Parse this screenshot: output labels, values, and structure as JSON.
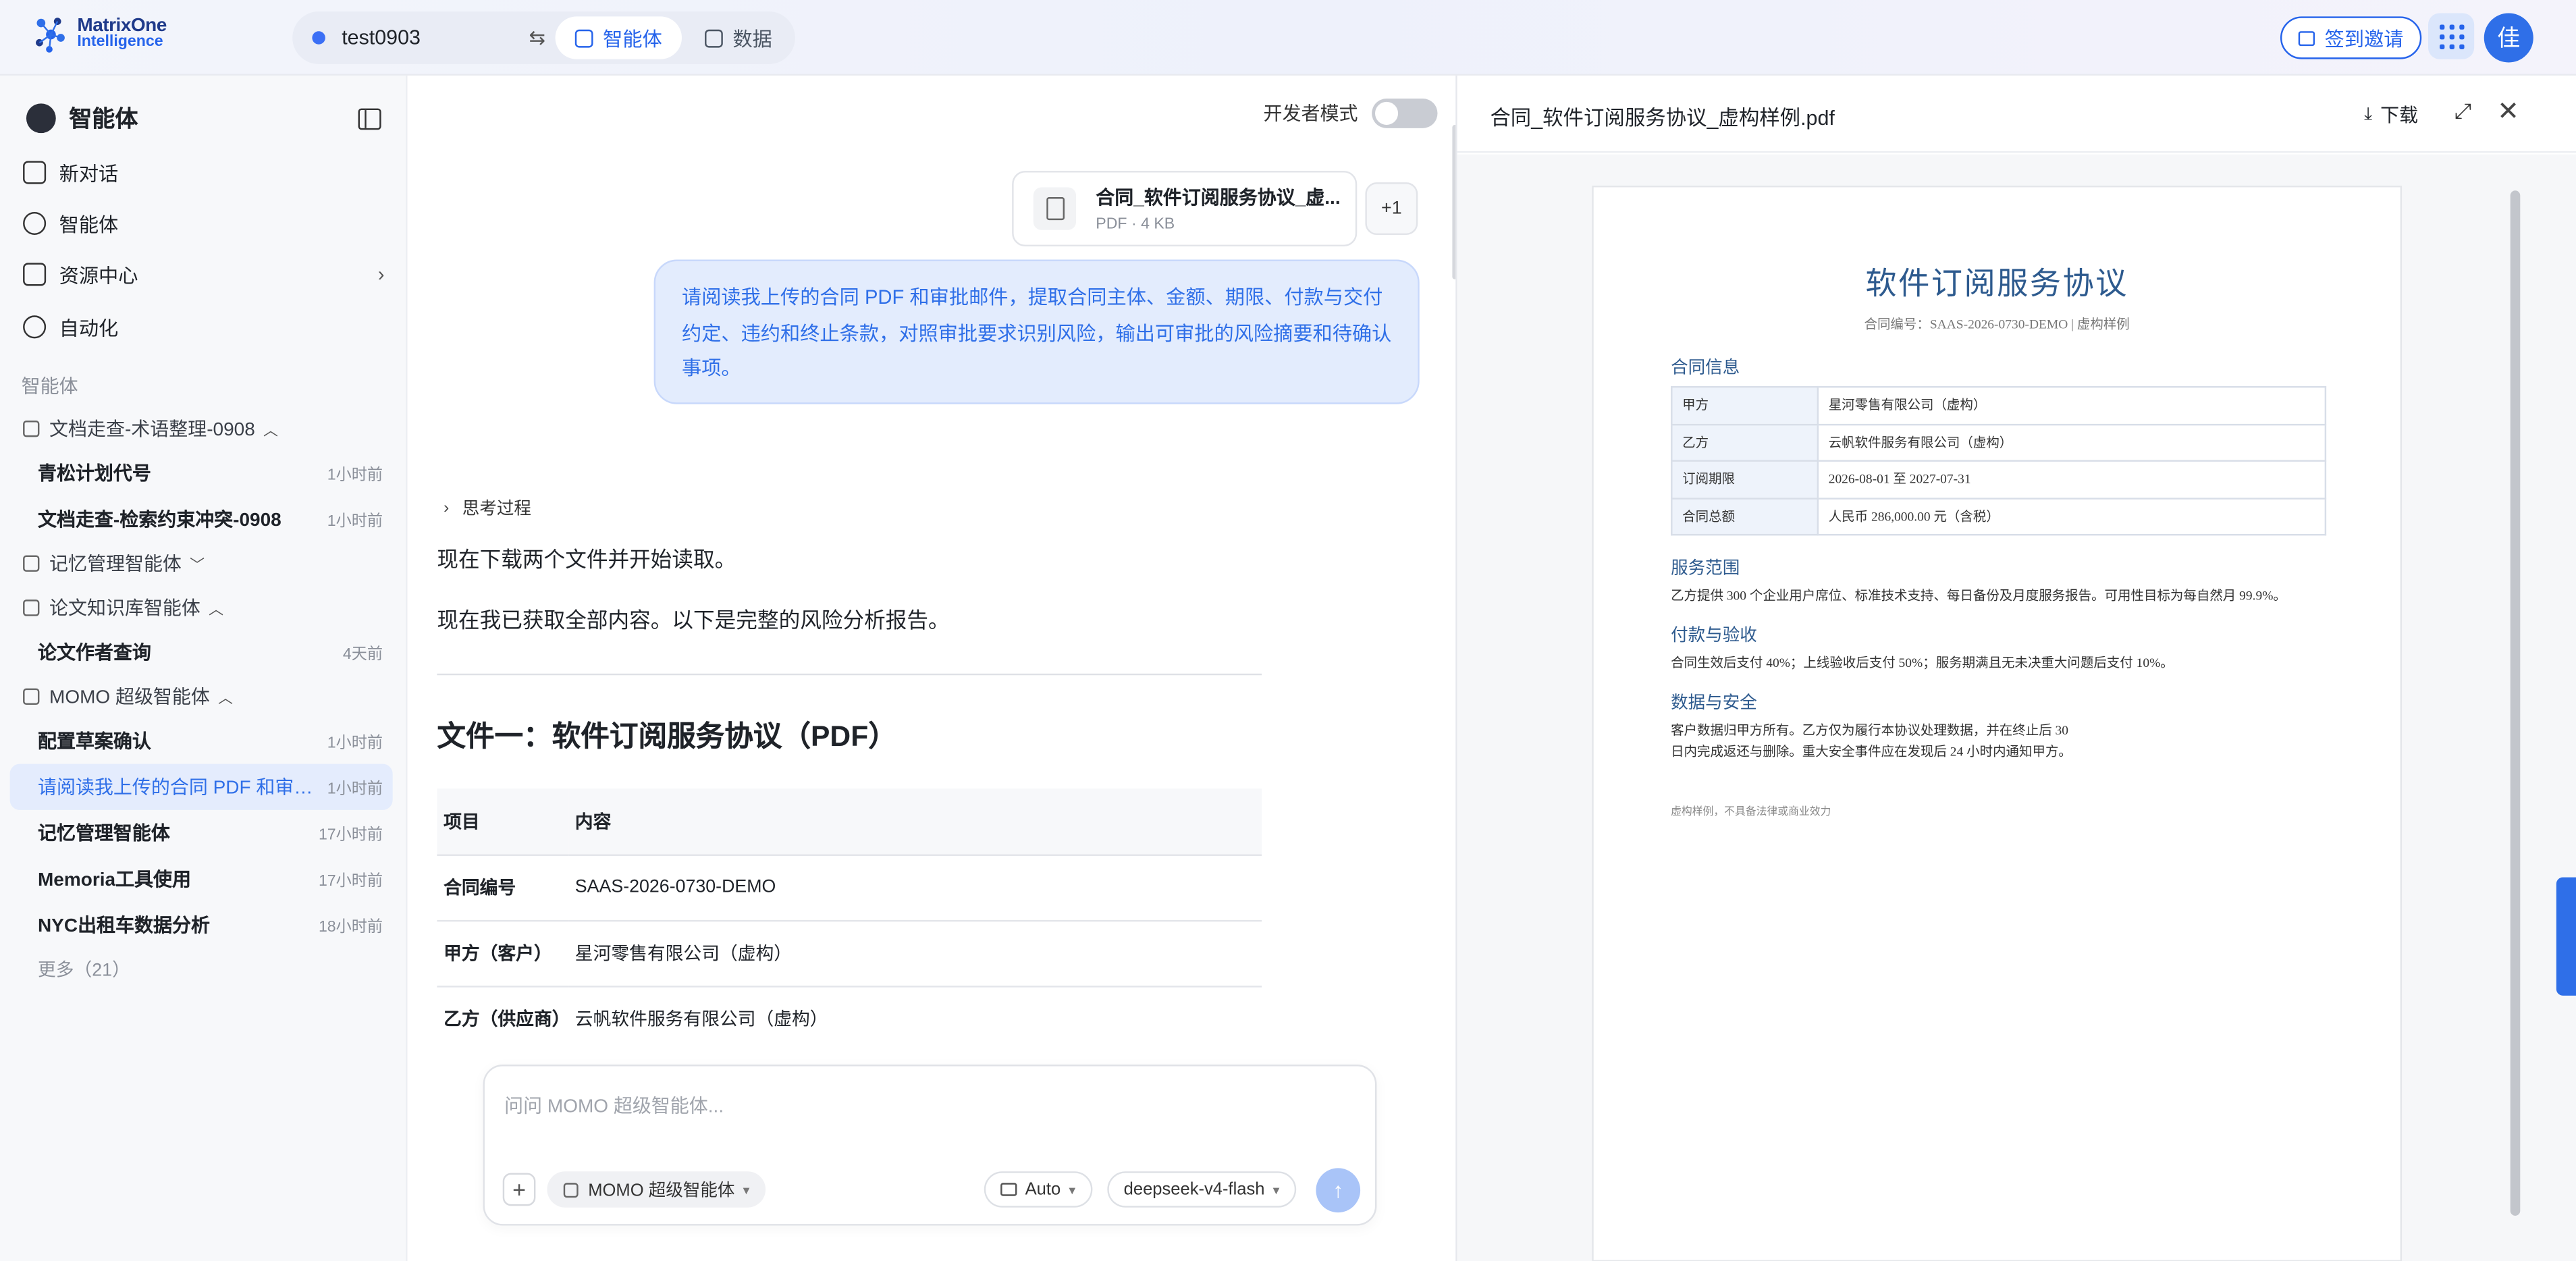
{
  "topbar": {
    "logo_line1": "MatrixOne",
    "logo_line2": "Intelligence",
    "workspace": "test0903",
    "workspace_swap_icon": "swap-icon",
    "tabs": [
      {
        "label": "智能体",
        "icon": "agent-icon"
      },
      {
        "label": "数据",
        "icon": "data-icon"
      }
    ],
    "invite_label": "签到邀请",
    "avatar_text": "佳",
    "accent": "#2563eb"
  },
  "sidebar": {
    "title": "智能体",
    "nav": [
      {
        "label": "新对话",
        "icon": "new-chat-icon"
      },
      {
        "label": "智能体",
        "icon": "robot-icon"
      },
      {
        "label": "资源中心",
        "icon": "grid-icon"
      },
      {
        "label": "自动化",
        "icon": "clock-icon"
      }
    ],
    "section_label": "智能体",
    "groups": [
      {
        "label": "文档走查-术语整理-0908",
        "caret": "^"
      },
      {
        "label": "记忆管理智能体",
        "caret": "v"
      },
      {
        "label": "论文知识库智能体",
        "caret": "^"
      },
      {
        "label": "MOMO 超级智能体",
        "caret": "^"
      }
    ],
    "items": [
      {
        "title": "青松计划代号",
        "time": "1小时前"
      },
      {
        "title": "文档走查-检索约束冲突-0908",
        "time": "1小时前"
      },
      {
        "title": "论文作者查询",
        "time": "4天前"
      },
      {
        "title": "配置草案确认",
        "time": "1小时前"
      },
      {
        "title": "请阅读我上传的合同 PDF 和审批邮件，提取合同主体、金额、期限、付款与交付约定、违约和终止条款",
        "time": "1小时前"
      },
      {
        "title": "记忆管理智能体",
        "time": "17小时前"
      },
      {
        "title": "Memoria工具使用",
        "time": "17小时前"
      },
      {
        "title": "NYC出租车数据分析",
        "time": "18小时前"
      }
    ],
    "more": "更多（21）"
  },
  "chat": {
    "dev_mode_label": "开发者模式",
    "dev_mode_on": false,
    "attachment": {
      "name": "合同_软件订阅服务协议_虚...",
      "meta": "PDF · 4 KB",
      "extra": "+1"
    },
    "user_message": "请阅读我上传的合同 PDF 和审批邮件，提取合同主体、金额、期限、付款与交付约定、违约和终止条款，对照审批要求识别风险，输出可审批的风险摘要和待确认事项。",
    "thinking_label": "思考过程",
    "para1": "现在下载两个文件并开始读取。",
    "para2": "现在我已获取全部内容。以下是完整的风险分析报告。",
    "heading": "文件一：软件订阅服务协议（PDF）",
    "table": {
      "headers": [
        "项目",
        "内容"
      ],
      "rows": [
        [
          "合同编号",
          "SAAS-2026-0730-DEMO"
        ],
        [
          "甲方（客户）",
          "星河零售有限公司（虚构）"
        ],
        [
          "乙方（供应商）",
          "云帆软件服务有限公司（虚构）"
        ]
      ]
    },
    "composer": {
      "placeholder": "问问 MOMO 超级智能体...",
      "agent": "MOMO 超级智能体",
      "mode": "Auto",
      "model": "deepseek-v4-flash"
    }
  },
  "preview": {
    "title": "合同_软件订阅服务协议_虚构样例.pdf",
    "download_label": "下载",
    "pdf": {
      "title": "软件订阅服务协议",
      "subtitle": "合同编号：SAAS-2026-0730-DEMO | 虚构样例",
      "sec_info": "合同信息",
      "info_rows": [
        [
          "甲方",
          "星河零售有限公司（虚构）"
        ],
        [
          "乙方",
          "云帆软件服务有限公司（虚构）"
        ],
        [
          "订阅期限",
          "2026-08-01 至 2027-07-31"
        ],
        [
          "合同总额",
          "人民币 286,000.00 元（含税）"
        ]
      ],
      "sec_scope": "服务范围",
      "scope_text": "乙方提供 300 个企业用户席位、标准技术支持、每日备份及月度服务报告。可用性目标为每自然月 99.9%。",
      "sec_pay": "付款与验收",
      "pay_text": "合同生效后支付 40%；上线验收后支付 50%；服务期满且无未决重大问题后支付 10%。",
      "sec_data": "数据与安全",
      "data_text1": "客户数据归甲方所有。乙方仅为履行本协议处理数据，并在终止后 30",
      "data_text2": "日内完成返还与删除。重大安全事件应在发现后 24 小时内通知甲方。",
      "footer": "虚构样例，不具备法律或商业效力"
    }
  }
}
